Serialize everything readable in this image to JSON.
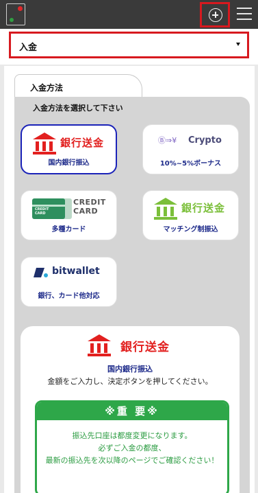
{
  "header": {
    "logo_name": "app-logo",
    "plus_icon": "plus-circle-icon",
    "menu_icon": "hamburger-menu-icon"
  },
  "select": {
    "value": "入金"
  },
  "tab": {
    "label": "入金方法"
  },
  "methods": {
    "instruction": "入金方法を選択して下さい",
    "items": [
      {
        "logo_text": "銀行送金",
        "label": "国内銀行振込"
      },
      {
        "logo_text": "Crypto",
        "label": "10%~5%ボーナス"
      },
      {
        "logo_text_line1": "CREDIT",
        "logo_text_line2": "CARD",
        "label": "多種カード"
      },
      {
        "logo_text": "銀行送金",
        "label": "マッチング制振込"
      },
      {
        "logo_text": "bitwallet",
        "label": "銀行、カード他対応"
      }
    ]
  },
  "detail": {
    "logo_text": "銀行送金",
    "subtitle": "国内銀行振込",
    "instruction": "金額をご入力し、決定ボタンを押してください。",
    "notice": {
      "title": "※重 要※",
      "lines": [
        "振込先口座は都度変更になります。",
        "必ずご入金の都度、",
        "最新の振込先を次以降のページでご確認ください！"
      ]
    }
  },
  "colors": {
    "header_bg": "#3a3a3a",
    "highlight_red": "#d7191f",
    "bank_red": "#e2201f",
    "bank_green": "#7bbf3a",
    "notice_green": "#2ea749",
    "label_blue": "#1d2a8a",
    "selected_border": "#1a22b8"
  }
}
